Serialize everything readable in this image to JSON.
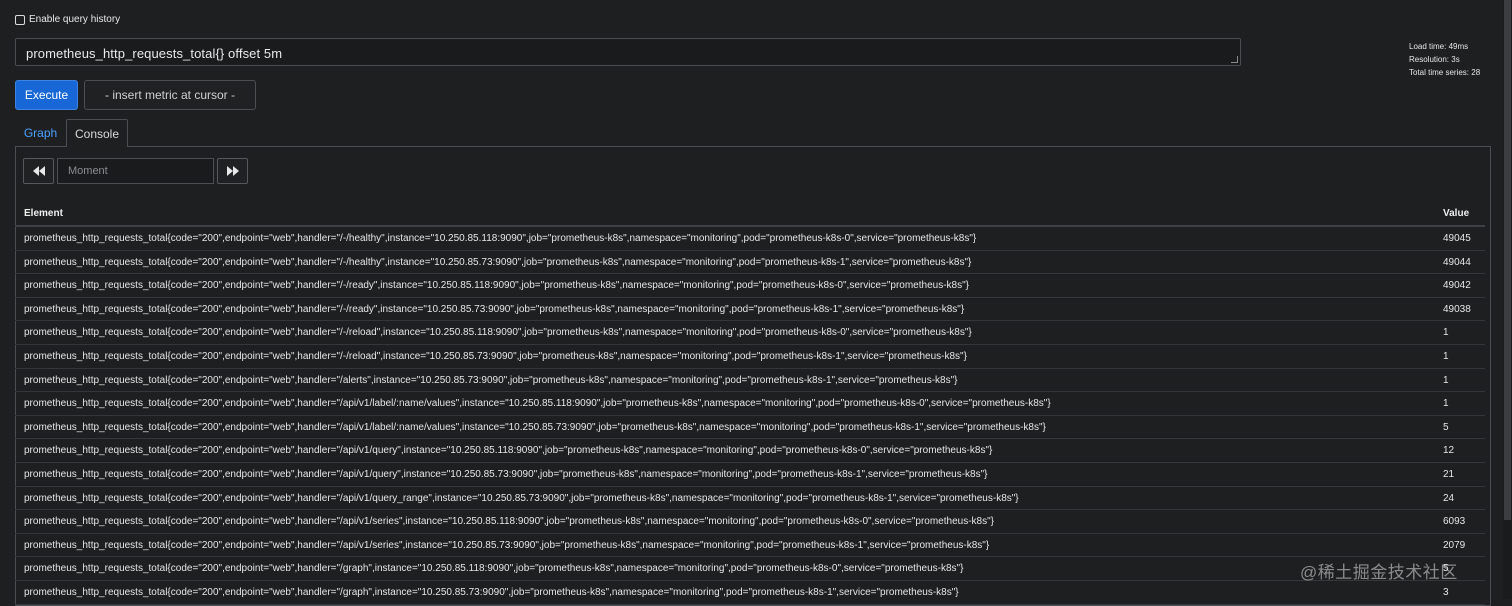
{
  "history": {
    "label": "Enable query history",
    "checked": false
  },
  "query": {
    "value": "prometheus_http_requests_total{} offset 5m"
  },
  "stats": {
    "load_time": "Load time: 49ms",
    "resolution": "Resolution: 3s",
    "total_series": "Total time series: 28"
  },
  "actions": {
    "execute_label": "Execute",
    "metric_select_label": "- insert metric at cursor -"
  },
  "tabs": [
    {
      "label": "Graph",
      "active": false
    },
    {
      "label": "Console",
      "active": true
    }
  ],
  "console": {
    "moment_placeholder": "Moment",
    "back_icon": "step-backward-icon",
    "forward_icon": "step-forward-icon"
  },
  "table": {
    "columns": [
      "Element",
      "Value"
    ],
    "rows": [
      {
        "element": "prometheus_http_requests_total{code=\"200\",endpoint=\"web\",handler=\"/-/healthy\",instance=\"10.250.85.118:9090\",job=\"prometheus-k8s\",namespace=\"monitoring\",pod=\"prometheus-k8s-0\",service=\"prometheus-k8s\"}",
        "value": "49045"
      },
      {
        "element": "prometheus_http_requests_total{code=\"200\",endpoint=\"web\",handler=\"/-/healthy\",instance=\"10.250.85.73:9090\",job=\"prometheus-k8s\",namespace=\"monitoring\",pod=\"prometheus-k8s-1\",service=\"prometheus-k8s\"}",
        "value": "49044"
      },
      {
        "element": "prometheus_http_requests_total{code=\"200\",endpoint=\"web\",handler=\"/-/ready\",instance=\"10.250.85.118:9090\",job=\"prometheus-k8s\",namespace=\"monitoring\",pod=\"prometheus-k8s-0\",service=\"prometheus-k8s\"}",
        "value": "49042"
      },
      {
        "element": "prometheus_http_requests_total{code=\"200\",endpoint=\"web\",handler=\"/-/ready\",instance=\"10.250.85.73:9090\",job=\"prometheus-k8s\",namespace=\"monitoring\",pod=\"prometheus-k8s-1\",service=\"prometheus-k8s\"}",
        "value": "49038"
      },
      {
        "element": "prometheus_http_requests_total{code=\"200\",endpoint=\"web\",handler=\"/-/reload\",instance=\"10.250.85.118:9090\",job=\"prometheus-k8s\",namespace=\"monitoring\",pod=\"prometheus-k8s-0\",service=\"prometheus-k8s\"}",
        "value": "1"
      },
      {
        "element": "prometheus_http_requests_total{code=\"200\",endpoint=\"web\",handler=\"/-/reload\",instance=\"10.250.85.73:9090\",job=\"prometheus-k8s\",namespace=\"monitoring\",pod=\"prometheus-k8s-1\",service=\"prometheus-k8s\"}",
        "value": "1"
      },
      {
        "element": "prometheus_http_requests_total{code=\"200\",endpoint=\"web\",handler=\"/alerts\",instance=\"10.250.85.73:9090\",job=\"prometheus-k8s\",namespace=\"monitoring\",pod=\"prometheus-k8s-1\",service=\"prometheus-k8s\"}",
        "value": "1"
      },
      {
        "element": "prometheus_http_requests_total{code=\"200\",endpoint=\"web\",handler=\"/api/v1/label/:name/values\",instance=\"10.250.85.118:9090\",job=\"prometheus-k8s\",namespace=\"monitoring\",pod=\"prometheus-k8s-0\",service=\"prometheus-k8s\"}",
        "value": "1"
      },
      {
        "element": "prometheus_http_requests_total{code=\"200\",endpoint=\"web\",handler=\"/api/v1/label/:name/values\",instance=\"10.250.85.73:9090\",job=\"prometheus-k8s\",namespace=\"monitoring\",pod=\"prometheus-k8s-1\",service=\"prometheus-k8s\"}",
        "value": "5"
      },
      {
        "element": "prometheus_http_requests_total{code=\"200\",endpoint=\"web\",handler=\"/api/v1/query\",instance=\"10.250.85.118:9090\",job=\"prometheus-k8s\",namespace=\"monitoring\",pod=\"prometheus-k8s-0\",service=\"prometheus-k8s\"}",
        "value": "12"
      },
      {
        "element": "prometheus_http_requests_total{code=\"200\",endpoint=\"web\",handler=\"/api/v1/query\",instance=\"10.250.85.73:9090\",job=\"prometheus-k8s\",namespace=\"monitoring\",pod=\"prometheus-k8s-1\",service=\"prometheus-k8s\"}",
        "value": "21"
      },
      {
        "element": "prometheus_http_requests_total{code=\"200\",endpoint=\"web\",handler=\"/api/v1/query_range\",instance=\"10.250.85.73:9090\",job=\"prometheus-k8s\",namespace=\"monitoring\",pod=\"prometheus-k8s-1\",service=\"prometheus-k8s\"}",
        "value": "24"
      },
      {
        "element": "prometheus_http_requests_total{code=\"200\",endpoint=\"web\",handler=\"/api/v1/series\",instance=\"10.250.85.118:9090\",job=\"prometheus-k8s\",namespace=\"monitoring\",pod=\"prometheus-k8s-0\",service=\"prometheus-k8s\"}",
        "value": "6093"
      },
      {
        "element": "prometheus_http_requests_total{code=\"200\",endpoint=\"web\",handler=\"/api/v1/series\",instance=\"10.250.85.73:9090\",job=\"prometheus-k8s\",namespace=\"monitoring\",pod=\"prometheus-k8s-1\",service=\"prometheus-k8s\"}",
        "value": "2079"
      },
      {
        "element": "prometheus_http_requests_total{code=\"200\",endpoint=\"web\",handler=\"/graph\",instance=\"10.250.85.118:9090\",job=\"prometheus-k8s\",namespace=\"monitoring\",pod=\"prometheus-k8s-0\",service=\"prometheus-k8s\"}",
        "value": "5"
      },
      {
        "element": "prometheus_http_requests_total{code=\"200\",endpoint=\"web\",handler=\"/graph\",instance=\"10.250.85.73:9090\",job=\"prometheus-k8s\",namespace=\"monitoring\",pod=\"prometheus-k8s-1\",service=\"prometheus-k8s\"}",
        "value": "3"
      }
    ]
  },
  "watermark": "@稀土掘金技术社区"
}
